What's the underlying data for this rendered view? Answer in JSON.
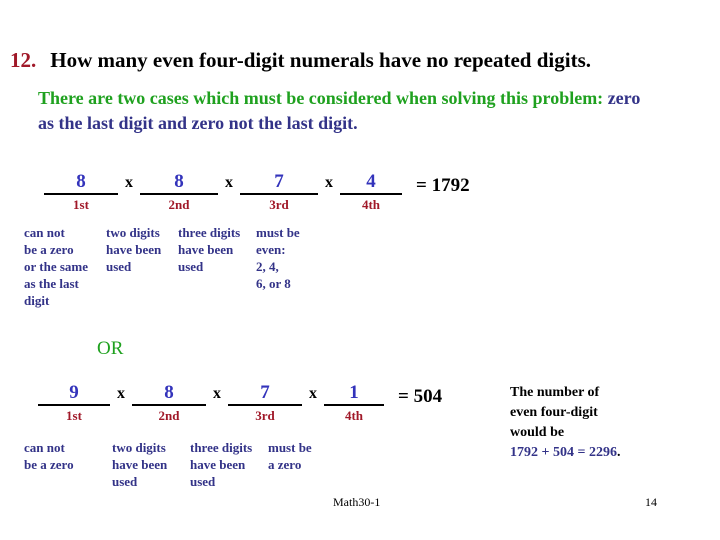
{
  "slide": {
    "question_number": "12.",
    "question_text": "How many even four-digit numerals have no repeated digits.",
    "intro": {
      "green_part": "There are two cases which must be considered when solving this problem:",
      "navy_part": " zero as the last digit and zero not the last digit."
    },
    "or_label": "OR"
  },
  "case1": {
    "slots": [
      {
        "digit": "8",
        "ordinal": "1st",
        "note": "can not\nbe a zero\nor the same\nas the last\ndigit"
      },
      {
        "digit": "8",
        "ordinal": "2nd",
        "note": "two digits\nhave been\nused"
      },
      {
        "digit": "7",
        "ordinal": "3rd",
        "note": "three digits\nhave been\nused"
      },
      {
        "digit": "4",
        "ordinal": "4th",
        "note": "must be\neven:\n2, 4,\n6, or 8"
      }
    ],
    "operator": "x",
    "result": "= 1792"
  },
  "case2": {
    "slots": [
      {
        "digit": "9",
        "ordinal": "1st",
        "note": "can not\nbe a zero"
      },
      {
        "digit": "8",
        "ordinal": "2nd",
        "note": "two digits\nhave been\nused"
      },
      {
        "digit": "7",
        "ordinal": "3rd",
        "note": "three digits\nhave been\nused"
      },
      {
        "digit": "1",
        "ordinal": "4th",
        "note": "must be\na zero"
      }
    ],
    "operator": "x",
    "result": "= 504"
  },
  "summary": {
    "line1": "The number of",
    "line2": "even four-digit",
    "line3": "would be",
    "equation": "1792 + 504 = 2296",
    "period": "."
  },
  "footer": {
    "course": "Math30-1",
    "page": "14"
  },
  "colors": {
    "question_number": "#a01828",
    "green": "#1fa11f",
    "navy": "#333388",
    "digit_blue": "#3333bb",
    "ordinal_red": "#a01828",
    "black": "#000000"
  }
}
